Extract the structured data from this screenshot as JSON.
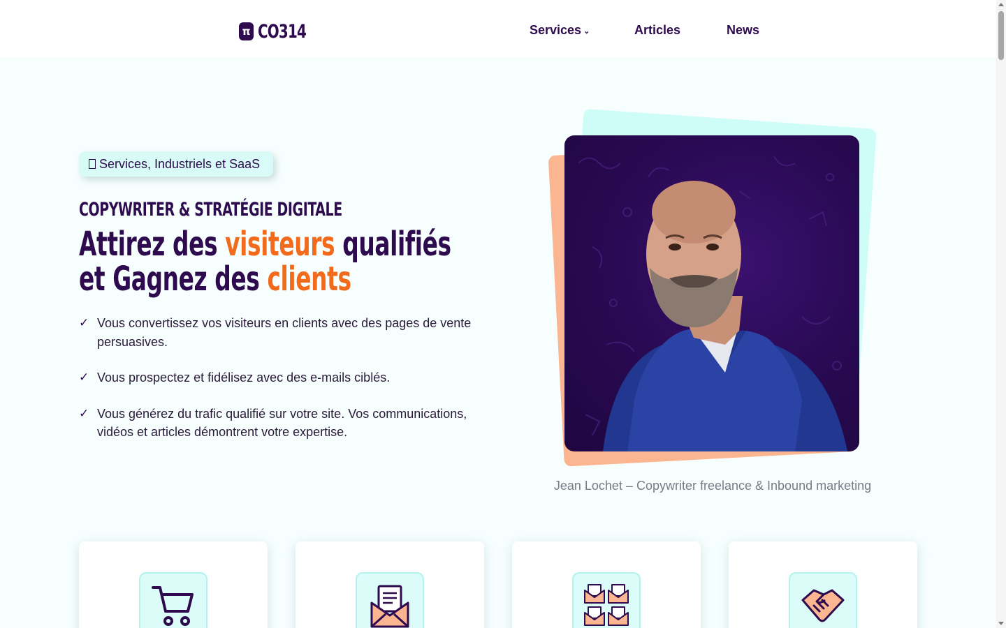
{
  "brand": {
    "logo_mark": "π",
    "logo_text": "CO314"
  },
  "nav": {
    "services": "Services",
    "articles": "Articles",
    "news": "News"
  },
  "hero": {
    "badge": "Services, Industriels et SaaS",
    "eyebrow": "COPYWRITER & STRATÉGIE DIGITALE",
    "headline": {
      "l1_a": "Attirez des ",
      "l1_accent": "visiteurs",
      "l1_b": " qualifiés",
      "l2_a": "et Gagnez des ",
      "l2_accent": "clients"
    },
    "bullets": [
      "Vous convertissez vos visiteurs en clients avec des pages de vente persuasives.",
      "Vous prospectez et fidélisez avec des e-mails ciblés.",
      "Vous générez du trafic qualifié sur votre site. Vos communications, vidéos et articles démontrent votre expertise."
    ],
    "check_glyph": "✓",
    "caption": "Jean Lochet – Copywriter freelance & Inbound marketing"
  },
  "cards": [
    {
      "icon": "shopping-cart-icon"
    },
    {
      "icon": "envelope-letter-icon"
    },
    {
      "icon": "mass-mailing-icon"
    },
    {
      "icon": "handshake-icon"
    }
  ],
  "colors": {
    "primary": "#2d0b4e",
    "accent": "#f26a1b",
    "mint": "#cefcf6",
    "peach": "#fbb591",
    "background": "#f7fefe"
  }
}
